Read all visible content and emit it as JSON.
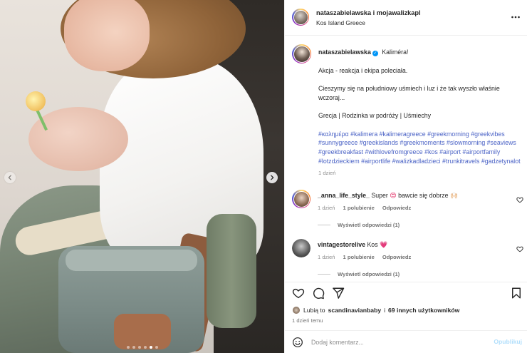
{
  "post": {
    "carousel": {
      "total_slides": 6,
      "active_index": 4
    },
    "header": {
      "title": "nataszabielawska i mojawalizkapl",
      "location": "Kos Island Greece",
      "more_icon": "more-horizontal-icon"
    },
    "caption": {
      "username": "nataszabielawska",
      "verified_mark": "✓",
      "first_line": "Kaliméra!",
      "lines": [
        "Akcja - reakcja i ekipa poleciała.",
        "Cieszymy się na południowy uśmiech i luz i że tak wyszło właśnie wczoraj...",
        "Grecja | Rodzinka w podróży | Uśmiechy"
      ],
      "hashtags": "#καλημέρα #kalimera #kalimeragreece #greekmorning #greekvibes #sunnygreece #greekislands #greekmoments #slowmorning #seaviews #greekbreakfast #withlovefromgreece #kos #airport #airportfamily #lotzdzieckiem #airportlife #walizkadladzieci #trunkitravels #gadzetynalot",
      "time": "1 dzień"
    },
    "comments": [
      {
        "username": "_anna_life_style_",
        "text_before": "Super",
        "emoji": "😍",
        "text_after": "bawcie się dobrze",
        "emoji2": "🙌🏻",
        "time": "1 dzień",
        "likes": "1 polubienie",
        "reply": "Odpowiedz",
        "view_replies": "Wyświetl odpowiedzi (1)"
      },
      {
        "username": "vintagestorelive",
        "text_before": "Kos",
        "emoji": "💗",
        "text_after": "",
        "emoji2": "",
        "time": "1 dzień",
        "likes": "1 polubienie",
        "reply": "Odpowiedz",
        "view_replies": "Wyświetl odpowiedzi (1)"
      }
    ],
    "likes_summary": {
      "prefix": "Lubią to",
      "user": "scandinavianbaby",
      "middle": "i",
      "others": "69 innych użytkowników"
    },
    "post_time": "1 dzień temu",
    "add_comment": {
      "placeholder": "Dodaj komentarz...",
      "post_label": "Opublikuj"
    }
  },
  "colors": {
    "link": "#4b63c6",
    "verified": "#0095f6",
    "muted": "#8e8e8e",
    "post_button_disabled": "#b2dffc"
  }
}
